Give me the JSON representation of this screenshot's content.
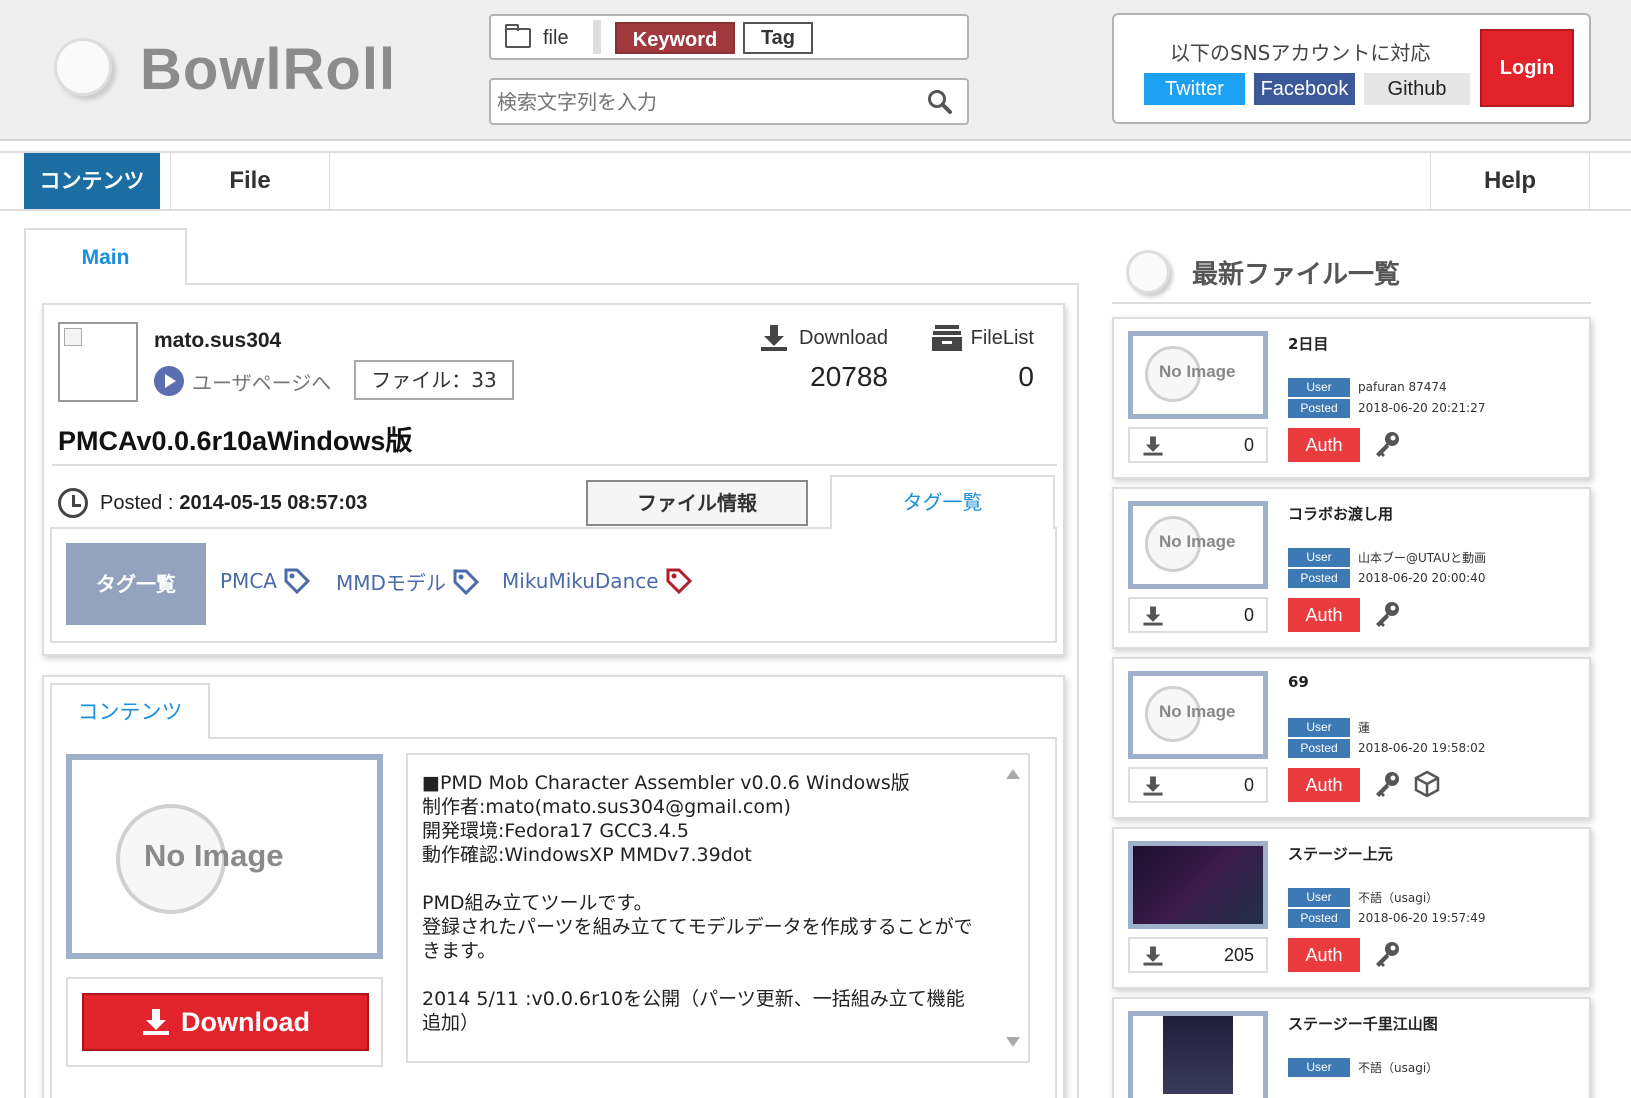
{
  "app": {
    "logo": "BowlRoll"
  },
  "search": {
    "types": {
      "file": "file",
      "keyword": "Keyword",
      "tag": "Tag"
    },
    "placeholder": "検索文字列を入力"
  },
  "sns": {
    "title": "以下のSNSアカウントに対応",
    "twitter": "Twitter",
    "facebook": "Facebook",
    "github": "Github",
    "login": "Login"
  },
  "nav": {
    "contents": "コンテンツ",
    "file": "File",
    "help": "Help"
  },
  "main_tab": "Main",
  "file": {
    "user": "mato.sus304",
    "userpage": "ユーザページへ",
    "file_count": "ファイル：33",
    "download_label": "Download",
    "download_count": "20788",
    "filelist_label": "FileList",
    "filelist_count": "0",
    "title": "PMCAv0.0.6r10aWindows版",
    "posted_label": "Posted :",
    "posted_date": "2014-05-15 08:57:03",
    "tab_fileinfo": "ファイル情報",
    "tab_taglist": "タグ一覧",
    "tag_header": "タグ一覧",
    "tags": [
      {
        "label": "PMCA",
        "color": "#4a6aa8"
      },
      {
        "label": "MMDモデル",
        "color": "#4a6aa8"
      },
      {
        "label": "MikuMikuDance",
        "color": "#b0202a"
      }
    ]
  },
  "contents": {
    "tab": "コンテンツ",
    "no_image": "No Image",
    "download_button": "Download",
    "description": "■PMD Mob Character Assembler v0.0.6 Windows版\n制作者:mato(mato.sus304@gmail.com)\n開発環境:Fedora17 GCC3.4.5\n動作確認:WindowsXP MMDv7.39dot\n\nPMD組み立てツールです。\n登録されたパーツを組み立ててモデルデータを作成することができます。\n\n2014 5/11 :v0.0.6r10を公開（パーツ更新、一括組み立て機能追加）"
  },
  "recent": {
    "title": "最新ファイル一覧",
    "user_label": "User",
    "posted_label": "Posted",
    "auth_label": "Auth",
    "no_image": "No Image",
    "items": [
      {
        "title": "2日目",
        "user": "pafuran 87474",
        "posted": "2018-06-20 20:21:27",
        "count": "0"
      },
      {
        "title": "コラボお渡し用",
        "user": "山本ブー@UTAUと動画",
        "posted": "2018-06-20 20:00:40",
        "count": "0"
      },
      {
        "title": "69",
        "user": "蓮",
        "posted": "2018-06-20 19:58:02",
        "count": "0"
      },
      {
        "title": "ステージー上元",
        "user": "不語（usagi）",
        "posted": "2018-06-20 19:57:49",
        "count": "205"
      },
      {
        "title": "ステージー千里江山图",
        "user": "不語（usagi）",
        "posted": "",
        "count": ""
      }
    ]
  }
}
